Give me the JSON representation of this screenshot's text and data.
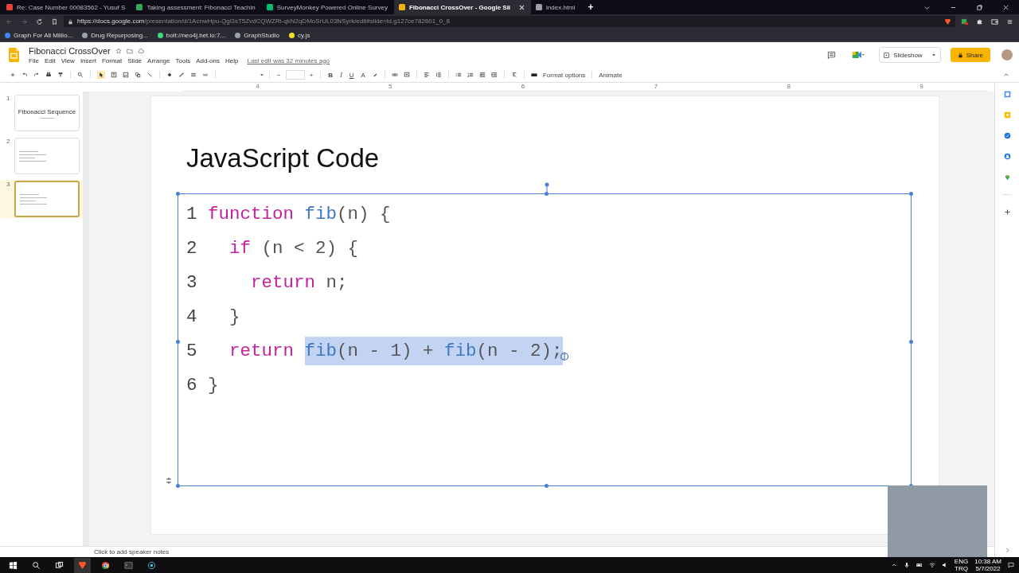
{
  "browser": {
    "tabs": [
      {
        "title": "Re: Case Number 00083562 - Yusuf S",
        "selected": false
      },
      {
        "title": "Taking assessment: Fibonacci Teachin",
        "selected": false
      },
      {
        "title": "SurveyMonkey Powered Online Survey",
        "selected": false
      },
      {
        "title": "Fibonacci CrossOver - Google Sli",
        "selected": true
      },
      {
        "title": "index.html",
        "selected": false
      }
    ],
    "new_tab": "+",
    "url_host": "https://docs.google.com",
    "url_path": "/presentation/d/1AcnwHpu-QgGsT5ZvdCQWZRi-qkN2qDMoSrUL03NSyrk/edit#slide=id.g127ce782601_0_8",
    "bookmarks": [
      "Graph For All Millio...",
      "Drug Repurposing...",
      "bolt://neo4j.het.io:7...",
      "GraphStudio",
      "cy.js"
    ]
  },
  "app": {
    "title": "Fibonacci CrossOver",
    "menus": [
      "File",
      "Edit",
      "View",
      "Insert",
      "Format",
      "Slide",
      "Arrange",
      "Tools",
      "Add-ons",
      "Help"
    ],
    "last_edit": "Last edit was 32 minutes ago",
    "slideshow": "Slideshow",
    "share": "Share"
  },
  "toolbar": {
    "font_minus": "−",
    "font_plus": "+",
    "format_buttons": [
      "B",
      "I",
      "U",
      "A"
    ],
    "format_options": "Format options",
    "animate": "Animate"
  },
  "ruler": {
    "marks": [
      "4",
      "5",
      "6",
      "7",
      "8",
      "9"
    ]
  },
  "slides": [
    {
      "number": "1",
      "title": "Fibonacci Sequence",
      "selected": false
    },
    {
      "number": "2",
      "selected": false
    },
    {
      "number": "3",
      "selected": true
    }
  ],
  "slide": {
    "title": "JavaScript Code",
    "code_lines": [
      {
        "number": "1",
        "tokens": [
          {
            "text": "function ",
            "kind": "keyword",
            "selected": false
          },
          {
            "text": "fib",
            "kind": "name",
            "selected": false
          },
          {
            "text": "(n) {",
            "kind": "plain",
            "selected": false
          }
        ]
      },
      {
        "number": "2",
        "tokens": [
          {
            "text": "  if",
            "kind": "keyword",
            "selected": false
          },
          {
            "text": " (n < 2) {",
            "kind": "plain",
            "selected": false
          }
        ]
      },
      {
        "number": "3",
        "tokens": [
          {
            "text": "    return",
            "kind": "keyword",
            "selected": false
          },
          {
            "text": " n;",
            "kind": "plain",
            "selected": false
          }
        ]
      },
      {
        "number": "4",
        "tokens": [
          {
            "text": "  }",
            "kind": "plain",
            "selected": false
          }
        ]
      },
      {
        "number": "5",
        "tokens": [
          {
            "text": "  return ",
            "kind": "keyword",
            "selected": false
          },
          {
            "text": "fib",
            "kind": "name",
            "selected": true
          },
          {
            "text": "(n - 1) + ",
            "kind": "plain",
            "selected": true
          },
          {
            "text": "fib",
            "kind": "name",
            "selected": true
          },
          {
            "text": "(n - 2);",
            "kind": "plain",
            "selected": true
          }
        ]
      },
      {
        "number": "6",
        "tokens": [
          {
            "text": "}",
            "kind": "plain",
            "selected": false
          }
        ]
      }
    ]
  },
  "speaker_notes": {
    "placeholder": "Click to add speaker notes"
  },
  "taskbar": {
    "language": "ENG",
    "layout": "TRQ",
    "time": "10:38 AM",
    "date": "5/7/2022"
  }
}
